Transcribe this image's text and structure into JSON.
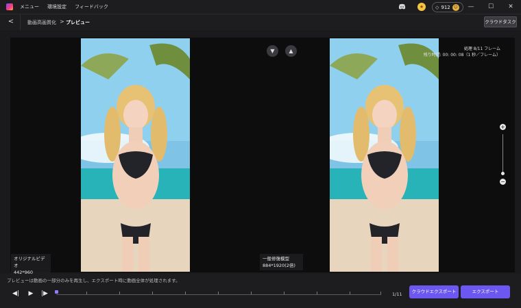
{
  "menu": {
    "items": [
      "メニュー",
      "環境設定",
      "フィードバック"
    ]
  },
  "account": {
    "credits": "912"
  },
  "breadcrumb": {
    "parent": "動画高画質化",
    "separator": ">",
    "current": "プレビュー"
  },
  "cloud_task_label": "クラウドタスク",
  "preview": {
    "processing": "処理 8/11 フレーム",
    "remaining": "残り時間: 00: 00: 08（1 秒／フレーム）",
    "original": {
      "title": "オリジナルビデオ",
      "resolution": "442*960"
    },
    "enhanced": {
      "title": "一般修復模型",
      "resolution": "884*1920(2倍)"
    }
  },
  "footer": {
    "note": "プレビューは動画の一部分のみを再生し、エクスポート時に動画全体が処理されます。",
    "counter": "1/11",
    "progress_fraction": 0,
    "cloud_export_label": "クラウドエクスポート",
    "export_label": "エクスポート"
  },
  "icons": {
    "back": "chevron-left-icon",
    "discord": "discord-icon",
    "coin": "coin-icon",
    "gem": "diamond-icon",
    "thumbs_down": "thumbs-down-icon",
    "thumbs_up": "thumbs-up-icon",
    "prev_frame": "step-back-icon",
    "play": "play-icon",
    "next_frame": "step-forward-icon",
    "zoom_in": "plus-icon",
    "zoom_out": "minus-icon"
  },
  "colors": {
    "accent": "#6c58f0",
    "background": "#1a1a1c",
    "stage": "#0d0d0e"
  }
}
